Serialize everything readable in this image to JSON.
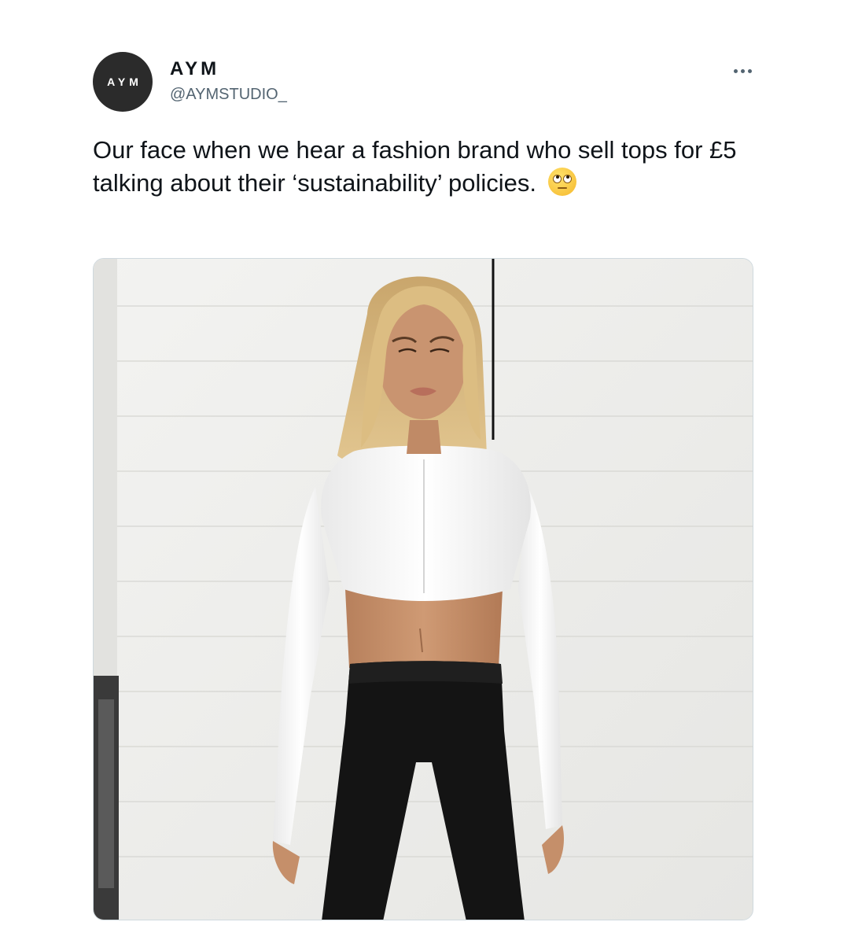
{
  "author": {
    "avatar_text": "AYM",
    "display_name": "AYM",
    "handle": "@AYMSTUDIO_"
  },
  "tweet": {
    "text": "Our face when we hear a fashion brand who sell tops for £5 talking about their ‘sustainability’ policies.",
    "emoji": "face-with-rolling-eyes-emoji"
  },
  "icons": {
    "more": "more-options-icon"
  },
  "colors": {
    "text": "#0f1419",
    "secondary": "#536471",
    "avatar_bg": "#2b2b2b",
    "border": "#cfd9de"
  }
}
